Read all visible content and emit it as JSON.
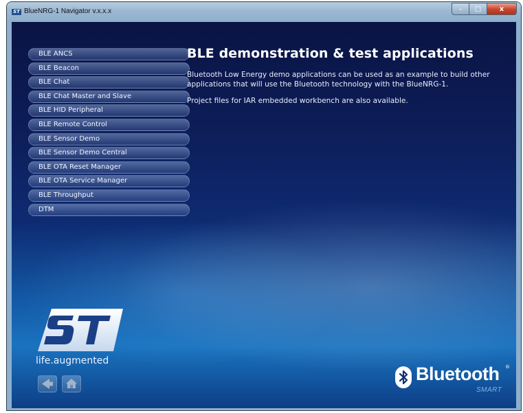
{
  "window": {
    "title": "BlueNRG-1 Navigator v.x.x.x",
    "app_icon_text": "ST",
    "controls": {
      "minimize": "–",
      "maximize": "□",
      "close": "x"
    }
  },
  "sidebar": {
    "items": [
      {
        "label": "BLE ANCS"
      },
      {
        "label": "BLE Beacon"
      },
      {
        "label": "BLE Chat"
      },
      {
        "label": "BLE Chat Master and Slave"
      },
      {
        "label": "BLE HID Peripheral"
      },
      {
        "label": "BLE Remote Control"
      },
      {
        "label": "BLE Sensor Demo"
      },
      {
        "label": "BLE Sensor Demo Central"
      },
      {
        "label": "BLE OTA Reset Manager"
      },
      {
        "label": "BLE OTA Service Manager"
      },
      {
        "label": "BLE Throughput"
      },
      {
        "label": "DTM"
      }
    ]
  },
  "main": {
    "heading": "BLE demonstration & test applications",
    "paragraph1": "Bluetooth Low Energy demo applications can be used as an example to build other applications that will use the Bluetooth technology with the BlueNRG-1.",
    "paragraph2": "Project files for IAR embedded workbench are also available."
  },
  "branding": {
    "tagline_prefix": "life",
    "tagline_dot": ".",
    "tagline_suffix": "augmented",
    "bluetooth_word": "Bluetooth",
    "bluetooth_reg": "®",
    "bluetooth_smart": "SMART"
  },
  "icons": {
    "back": "back-arrow-icon",
    "home": "home-icon",
    "bluetooth": "bluetooth-rune-icon",
    "st_logo": "st-logo-icon"
  },
  "colors": {
    "background_top": "#0a1444",
    "background_bottom": "#1a73bf",
    "close_button": "#c8432b",
    "titlebar": "#9db9d3"
  }
}
